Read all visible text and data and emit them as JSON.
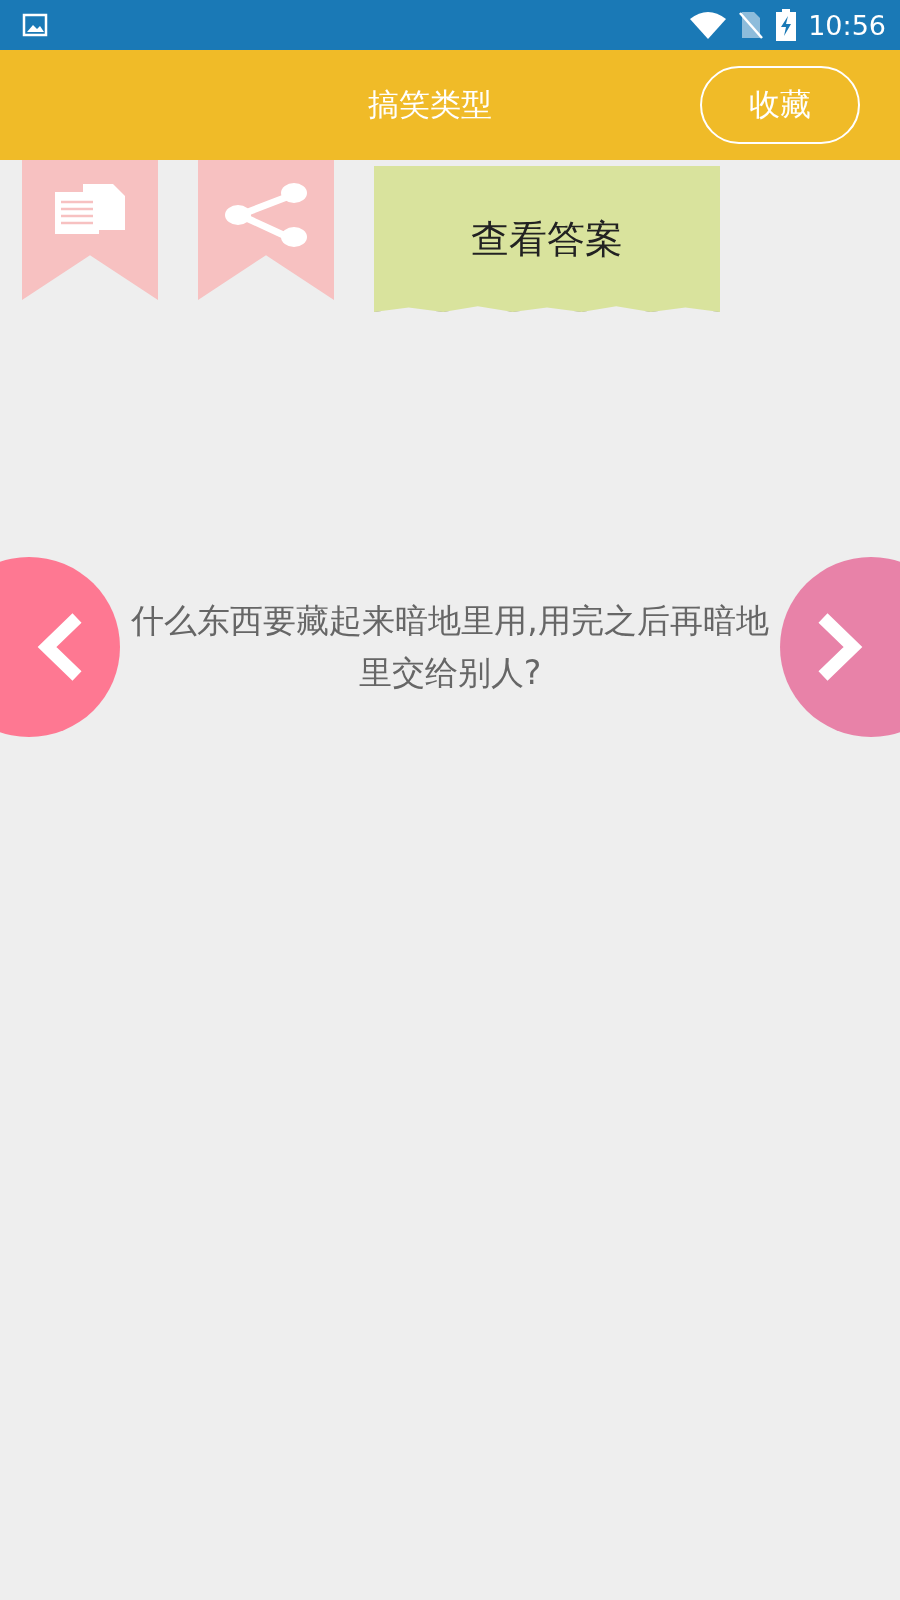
{
  "status_bar": {
    "time": "10:56"
  },
  "header": {
    "title": "搞笑类型",
    "favorite_button": "收藏"
  },
  "actions": {
    "answer_button": "查看答案"
  },
  "question": {
    "text": "什么东西要藏起来暗地里用,用完之后再暗地里交给别人?"
  }
}
